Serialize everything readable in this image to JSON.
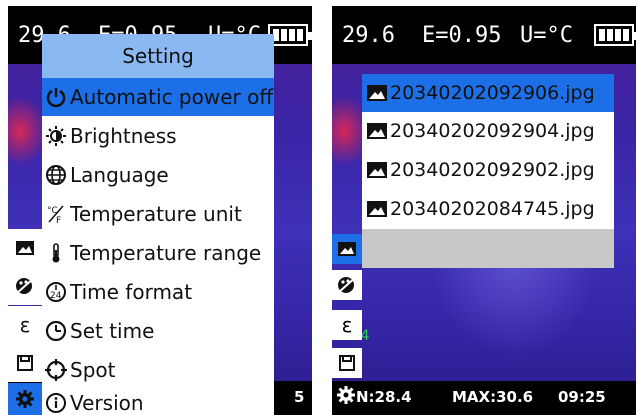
{
  "left_screen": {
    "status": {
      "temperature": "29.6",
      "emissivity": "E=0.95",
      "unit": "U=°C"
    },
    "menu": {
      "title": "Setting",
      "items": [
        {
          "label": "Automatic power off",
          "icon": "power-icon",
          "selected": true
        },
        {
          "label": "Brightness",
          "icon": "brightness-icon",
          "selected": false
        },
        {
          "label": "Language",
          "icon": "globe-icon",
          "selected": false
        },
        {
          "label": "Temperature unit",
          "icon": "temperature-unit-icon",
          "selected": false
        },
        {
          "label": "Temperature range",
          "icon": "thermometer-icon",
          "selected": false
        },
        {
          "label": "Time format",
          "icon": "time-24-icon",
          "selected": false
        },
        {
          "label": "Set time",
          "icon": "clock-icon",
          "selected": false
        },
        {
          "label": "Spot",
          "icon": "crosshair-icon",
          "selected": false
        },
        {
          "label": "Version",
          "icon": "info-icon",
          "selected": false
        }
      ]
    },
    "bottom_right_fragment": "5"
  },
  "right_screen": {
    "status": {
      "temperature": "29.6",
      "emissivity": "E=0.95",
      "unit": "U=°C"
    },
    "files": [
      {
        "name": "20340202092906.jpg",
        "selected": true
      },
      {
        "name": "20340202092904.jpg",
        "selected": false
      },
      {
        "name": "20340202092902.jpg",
        "selected": false
      },
      {
        "name": "20340202084745.jpg",
        "selected": false
      }
    ],
    "side_value": ".4",
    "bottom": {
      "min": "N:28.4",
      "max": "MAX:30.6",
      "time": "09:25"
    }
  },
  "side_glyphs": {
    "epsilon": "ε"
  },
  "colors": {
    "selection": "#1d6fe8",
    "menu_title_bg": "#8ab8f0",
    "empty_row": "#c8c8c8"
  }
}
